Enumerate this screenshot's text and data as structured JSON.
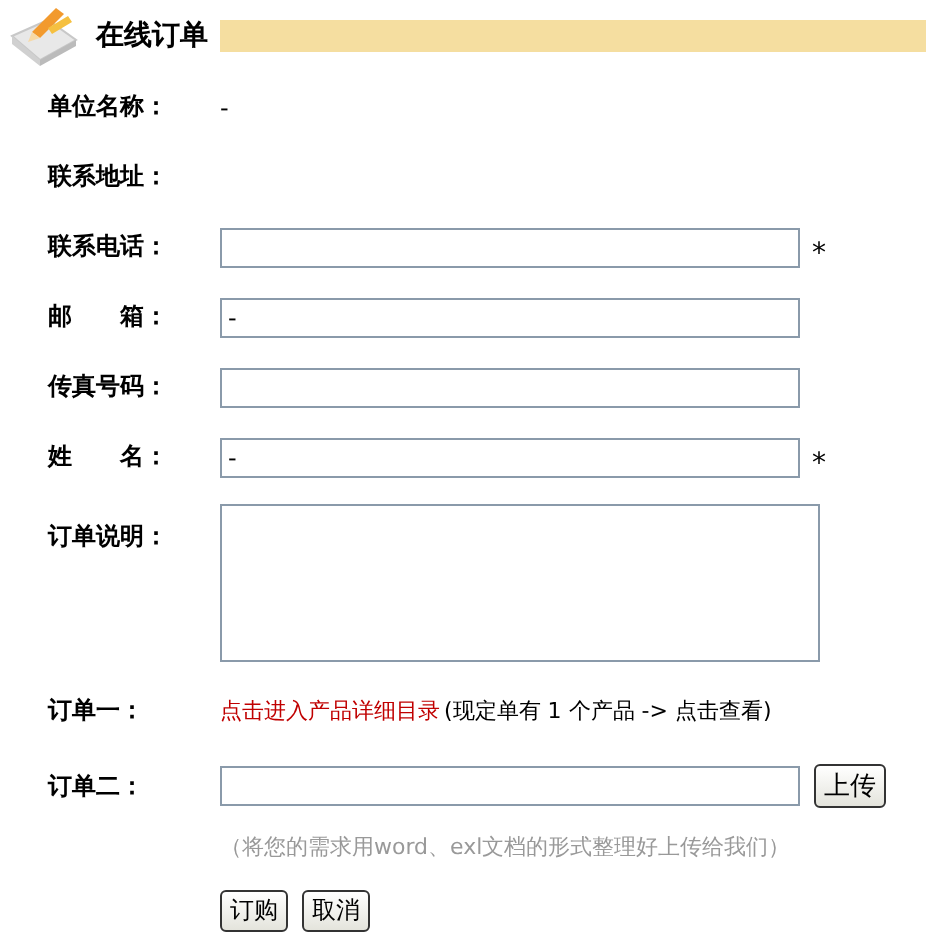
{
  "header": {
    "title": "在线订单"
  },
  "fields": [
    {
      "kind": "text",
      "label": "单位名称：",
      "value": "-"
    },
    {
      "kind": "text",
      "label": "联系地址："
    },
    {
      "kind": "input",
      "label": "联系电话：",
      "mark": "*"
    },
    {
      "kind": "input",
      "label": "邮　　箱：",
      "value": "-"
    },
    {
      "kind": "input",
      "label": "传真号码："
    },
    {
      "kind": "input",
      "label": "姓　　名：",
      "value": "-",
      "mark": "*"
    },
    {
      "kind": "textarea",
      "label": "订单说明："
    },
    {
      "kind": "link",
      "label": "订单一：",
      "link": "点击进入产品详细目录",
      "note": "(现定单有 1 个产品 -> 点击查看)"
    },
    {
      "kind": "upload",
      "label": "订单二：",
      "button": "上传"
    }
  ],
  "hint": "（将您的需求用word、exl文档的形式整理好上传给我们）",
  "buttons": [
    "订购",
    "取消"
  ]
}
